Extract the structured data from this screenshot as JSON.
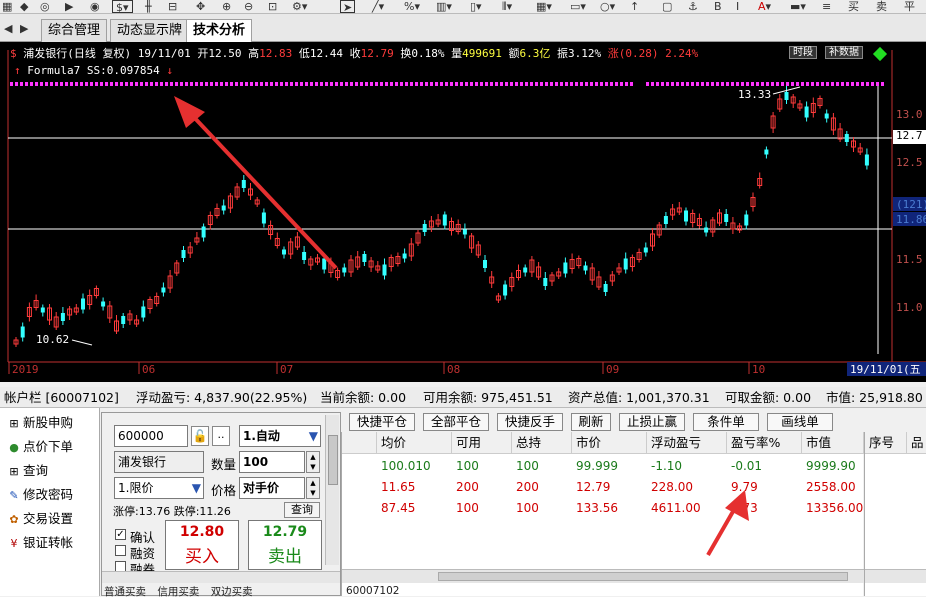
{
  "tabs": [
    "综合管理",
    "动态显示牌",
    "技术分析"
  ],
  "chart": {
    "code_mark": "$",
    "stock_name": "浦发银行(日线 复权) 19/11/01",
    "open_label": "开",
    "open": "12.50",
    "high_label": "高",
    "high": "12.83",
    "low_label": "低",
    "low": "12.44",
    "close_label": "收",
    "close": "12.79",
    "turnover_label": "换",
    "turnover": "0.18%",
    "volume_label": "量",
    "volume": "499691",
    "amount_label": "额",
    "amount": "6.3亿",
    "amplitude_label": "振",
    "amplitude": "3.12%",
    "change_label": "涨",
    "change": "(0.28) 2.24%",
    "btn_period": "时段",
    "btn_fill": "补数据",
    "formula": "Formula7 SS:0.097854",
    "annotation_high": "13.33",
    "annotation_low": "10.62",
    "price_labels": [
      {
        "text": "13.0",
        "color": "#c0504d"
      },
      {
        "text": "12.7",
        "color": "#ffffff"
      },
      {
        "text": "12.5",
        "color": "#c0504d"
      },
      {
        "text": "(121)",
        "color": "#4a7bd0"
      },
      {
        "text": "11.86",
        "color": "#4a7bd0"
      },
      {
        "text": "11.5",
        "color": "#c0504d"
      },
      {
        "text": "11.0",
        "color": "#c0504d"
      }
    ],
    "date_labels": [
      "2019",
      "06",
      "07",
      "08",
      "09",
      "10"
    ],
    "end_date": "19/11/01(五",
    "colors": {
      "up": "#ff3b3b",
      "down": "#33ffff",
      "marker": "#ff33ff",
      "arrow": "#e53030"
    }
  },
  "account_bar": {
    "account": "帐户栏 [60007102]",
    "float_pl": "浮动盈亏: 4,837.90(22.95%)",
    "balance": "当前余额: 0.00",
    "available": "可用余额: 975,451.51",
    "total": "资产总值: 1,001,370.31",
    "withdrawable": "可取金额: 0.00",
    "market_value": "市值: 25,918.80"
  },
  "menu": [
    {
      "icon": "plus-box-icon",
      "glyph": "⊞",
      "label": "新股申购",
      "color": "#000"
    },
    {
      "icon": "cart-icon",
      "glyph": "●",
      "label": "点价下单",
      "color": "#2e8b2e"
    },
    {
      "icon": "plus-box-icon",
      "glyph": "⊞",
      "label": "查询",
      "color": "#000"
    },
    {
      "icon": "pencil-icon",
      "glyph": "✎",
      "label": "修改密码",
      "color": "#1a4fb5"
    },
    {
      "icon": "gear-icon",
      "glyph": "✿",
      "label": "交易设置",
      "color": "#c06000"
    },
    {
      "icon": "yen-icon",
      "glyph": "¥",
      "label": "银证转帐",
      "color": "#b00000"
    }
  ],
  "order": {
    "code": "600000",
    "name": "浦发银行",
    "qty_label": "数量",
    "qty": "100",
    "order_type": "1.限价",
    "price_label": "价格",
    "price": "对手价",
    "auto": "1.自动",
    "limit_text": "涨停:13.76 跌停:11.26",
    "query_btn": "查询",
    "confirm": "确认",
    "margin": "融资",
    "short": "融券",
    "buy_price": "12.80",
    "buy_label": "买入",
    "sell_price": "12.79",
    "sell_label": "卖出",
    "bottom_tabs": [
      "普通买卖",
      "信用买卖",
      "双边买卖"
    ]
  },
  "buttons": [
    "快捷平仓",
    "全部平仓",
    "快捷反手",
    "刷新",
    "止损止赢",
    "条件单",
    "画线单"
  ],
  "table": {
    "headers": [
      "均价",
      "可用",
      "总持",
      "市价",
      "浮动盈亏",
      "盈亏率%",
      "市值"
    ],
    "rows": [
      {
        "color": "#1a7a1a",
        "cells": [
          "100.010",
          "100",
          "100",
          "99.999",
          "-1.10",
          "-0.01",
          "9999.90"
        ]
      },
      {
        "color": "#d00000",
        "cells": [
          "11.65",
          "200",
          "200",
          "12.79",
          "228.00",
          "9.79",
          "2558.00"
        ]
      },
      {
        "color": "#d00000",
        "cells": [
          "87.45",
          "100",
          "100",
          "133.56",
          "4611.00",
          "5.73",
          "13356.00"
        ]
      }
    ],
    "footer": "60007102"
  },
  "right_panel": {
    "headers": [
      "序号",
      "品"
    ]
  }
}
